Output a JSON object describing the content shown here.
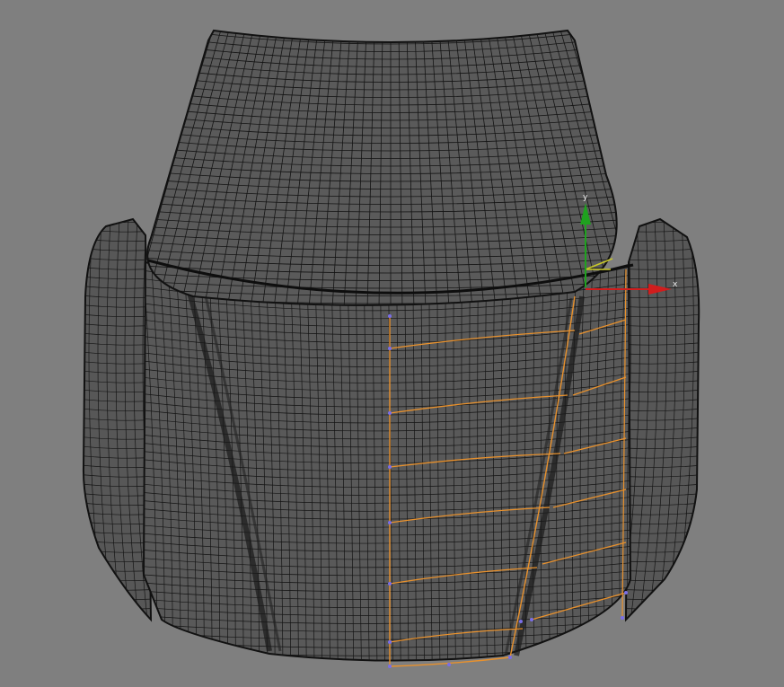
{
  "viewport": {
    "background": "#7f7f7f",
    "mode": "wireframe-on-shaded"
  },
  "model": {
    "shaded_color": "#585858",
    "wire_color": "#141414",
    "selection_color": "#e8912d",
    "vertex_color": "#7a6ee8"
  },
  "gizmo": {
    "x_label": "x",
    "y_label": "y",
    "x_color": "#d11d1d",
    "y_color": "#1fa21f",
    "z_color": "#c8c828"
  }
}
